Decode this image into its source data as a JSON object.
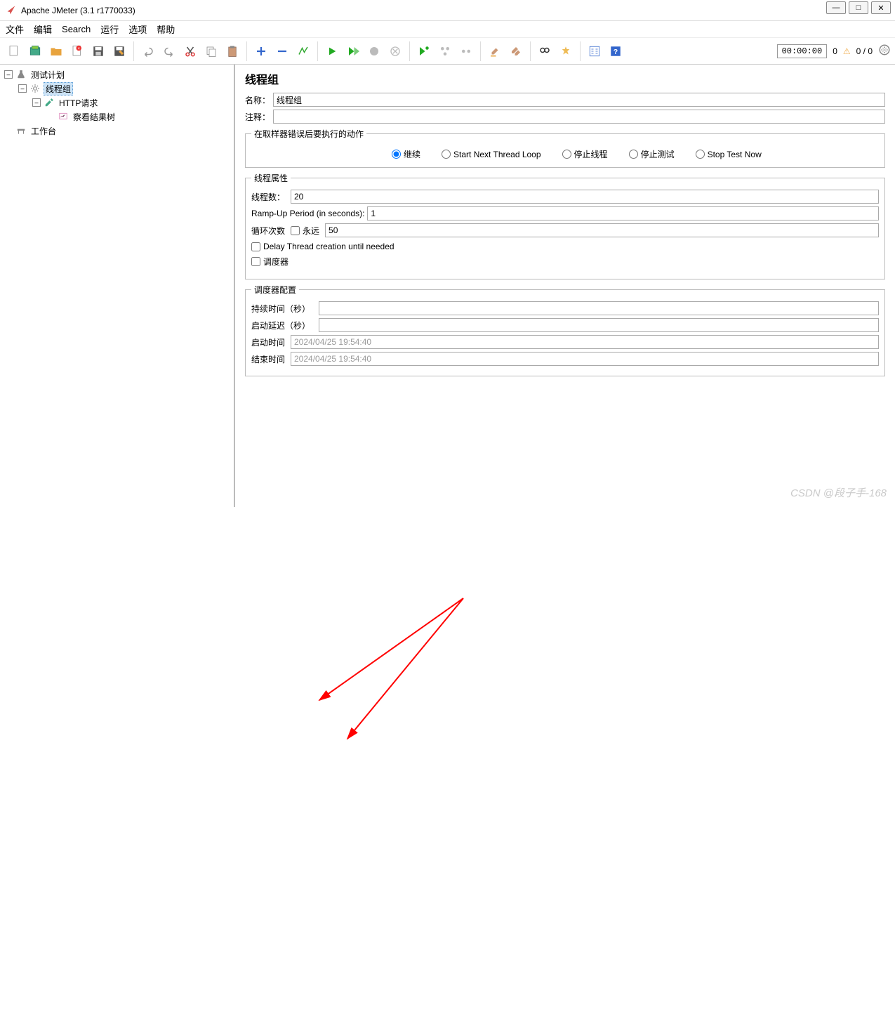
{
  "window": {
    "title": "Apache JMeter (3.1 r1770033)"
  },
  "menu": {
    "file": "文件",
    "edit": "编辑",
    "search": "Search",
    "run": "运行",
    "options": "选项",
    "help": "帮助"
  },
  "status": {
    "time": "00:00:00",
    "errors": "0",
    "threads": "0 / 0"
  },
  "tree": {
    "testplan": "测试计划",
    "threadgroup": "线程组",
    "httprequest": "HTTP请求",
    "viewresults": "察看结果树",
    "workbench": "工作台"
  },
  "panel": {
    "title": "线程组",
    "name_label": "名称：",
    "name_value": "线程组",
    "comment_label": "注释：",
    "comment_value": "",
    "onerror_legend": "在取样器错误后要执行的动作",
    "radio": {
      "cont": "继续",
      "next": "Start Next Thread Loop",
      "stopthread": "停止线程",
      "stoptest": "停止测试",
      "stopnow": "Stop Test Now"
    },
    "props_legend": "线程属性",
    "threads_label": "线程数：",
    "threads_value": "20",
    "rampup_label": "Ramp-Up Period (in seconds):",
    "rampup_value": "1",
    "loop_label": "循环次数",
    "forever_label": "永远",
    "loop_value": "50",
    "delay_create": "Delay Thread creation until needed",
    "scheduler": "调度器",
    "sched_legend": "调度器配置",
    "duration_label": "持续时间（秒）",
    "delay_label": "启动延迟（秒）",
    "start_label": "启动时间",
    "start_value": "2024/04/25 19:54:40",
    "end_label": "结束时间",
    "end_value": "2024/04/25 19:54:40"
  },
  "watermark": "CSDN @段子手-168"
}
